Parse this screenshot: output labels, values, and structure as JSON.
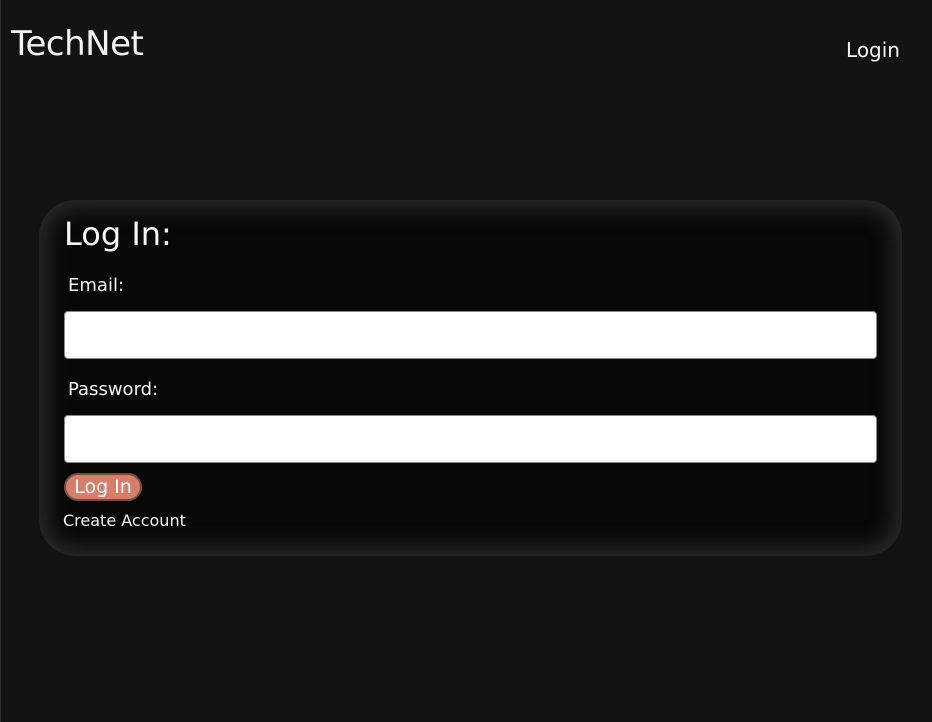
{
  "header": {
    "brand": "TechNet",
    "nav_login": "Login"
  },
  "login_form": {
    "title": "Log In:",
    "email_label": "Email:",
    "email_value": "",
    "password_label": "Password:",
    "password_value": "",
    "submit_label": "Log In",
    "create_account_label": "Create Account"
  },
  "colors": {
    "background": "#131313",
    "card": "#090807",
    "button": "#d47e6c"
  }
}
